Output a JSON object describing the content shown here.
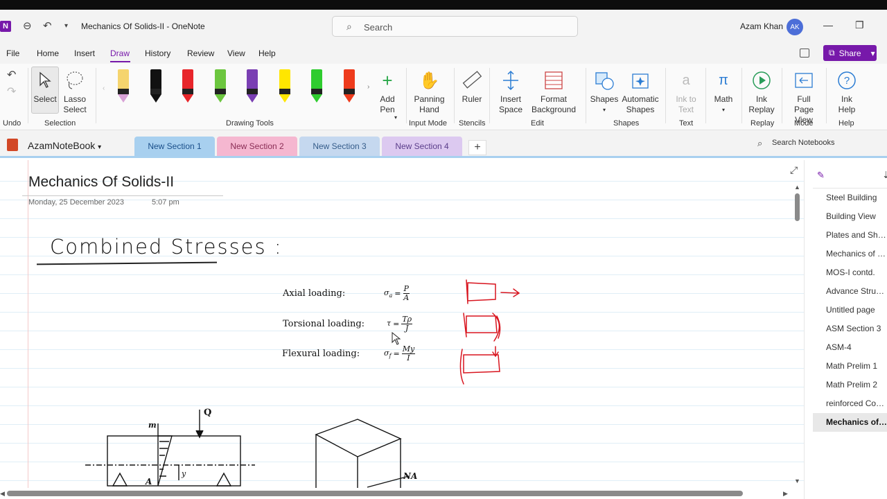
{
  "titlebar": {
    "title": "Mechanics Of Solids-II  -  OneNote",
    "search_placeholder": "Search",
    "user_name": "Azam Khan",
    "user_initials": "AK"
  },
  "menu": {
    "items": [
      "File",
      "Home",
      "Insert",
      "Draw",
      "History",
      "Review",
      "View",
      "Help"
    ],
    "active": "Draw",
    "share_label": "Share"
  },
  "ribbon": {
    "select": "Select",
    "lasso": "Lasso Select",
    "add_pen": "Add Pen",
    "panning": "Panning Hand",
    "ruler": "Ruler",
    "insert_space": "Insert Space",
    "format_bg": "Format Background",
    "shapes": "Shapes",
    "auto_shapes": "Automatic Shapes",
    "ink_to_text": "Ink to Text",
    "math": "Math",
    "ink_replay": "Ink Replay",
    "full_page": "Full Page View",
    "ink_help": "Ink Help",
    "groups": {
      "undo": "Undo",
      "selection": "Selection",
      "drawing_tools": "Drawing Tools",
      "input_mode": "Input Mode",
      "stencils": "Stencils",
      "edit": "Edit",
      "shapes": "Shapes",
      "text": "Text",
      "replay": "Replay",
      "mode": "Mode",
      "help": "Help"
    },
    "pen_colors": [
      "#f5d46e",
      "#111111",
      "#e8262b",
      "#6cc63f",
      "#7a3fb3",
      "#ffe600",
      "#2fcc2f",
      "#ee3b1c"
    ]
  },
  "notebook": {
    "name": "AzamNoteBook",
    "search_label": "Search Notebooks",
    "sections": [
      {
        "label": "New Section 1",
        "bg": "#a8d0ef",
        "color": "#1a4f8a"
      },
      {
        "label": "New Section 2",
        "bg": "#f5b7d0",
        "color": "#8a2d55"
      },
      {
        "label": "New Section 3",
        "bg": "#c5d8ef",
        "color": "#355c8a"
      },
      {
        "label": "New Section 4",
        "bg": "#dcc9f0",
        "color": "#5a3d8a"
      }
    ]
  },
  "page": {
    "title": "Mechanics Of Solids-II",
    "date": "Monday, 25 December 2023",
    "time": "5:07 pm",
    "handwritten_heading": "Combined Stresses :",
    "loadings": [
      {
        "label": "Axial loading:",
        "symbol": "σ",
        "sub": "a",
        "num": "P",
        "den": "A"
      },
      {
        "label": "Torsional loading:",
        "symbol": "τ",
        "sub": "",
        "num": "Tρ",
        "den": "J"
      },
      {
        "label": "Flexural loading:",
        "symbol": "σ",
        "sub": "f",
        "num": "My",
        "den": "I"
      }
    ],
    "diagram_labels": {
      "load": "Q",
      "m": "m",
      "a": "A",
      "y": "y",
      "na": "NA"
    }
  },
  "pages": {
    "items": [
      "Steel Building",
      "Building View",
      "Plates and Shell ...",
      "Mechanics of S...",
      "MOS-I contd.",
      "Advance Struct...",
      "Untitled page",
      "ASM Section 3",
      "ASM-4",
      "Math Prelim 1",
      "Math Prelim 2",
      "reinforced Conc...",
      "Mechanics of S..."
    ],
    "active_index": 12
  },
  "colors": {
    "accent": "#7719aa",
    "ink_red": "#d8141e"
  }
}
